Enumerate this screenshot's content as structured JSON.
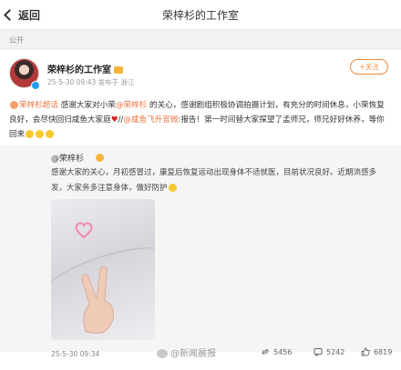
{
  "topbar": {
    "back_label": "返回",
    "title": "荣梓杉的工作室"
  },
  "visibility": "公开",
  "post": {
    "author": "荣梓杉的工作室",
    "meta": "25-5-30 09:43  发布于 浙江",
    "follow_label": "+关注",
    "content_parts": {
      "tag1": "荣梓杉超话",
      "t1": " 感谢大家对小荣",
      "mention1": "@荣梓杉",
      "t2": " 的关心，感谢剧组积极协调拍摄计划，有充分的时间休息，小荣恢复良好，会尽快回归咸鱼大家庭",
      "t3": "//",
      "mention2": "@咸鱼飞升官微",
      "t4": ":报告！第一时间替大家探望了孟师兄，师兄好好休养，等你回来"
    }
  },
  "repost": {
    "author": "@荣梓杉",
    "text": "感谢大家的关心，月初感冒过，康复后恢复运动出现身体不适就医，目前状况良好。近期流感多发，大家务多注意身体，做好防护",
    "date": "25-5-30 09:34"
  },
  "stats": {
    "reposts": "5456",
    "comments": "5242",
    "likes": "6819"
  },
  "watermark": "@新闻晨报"
}
